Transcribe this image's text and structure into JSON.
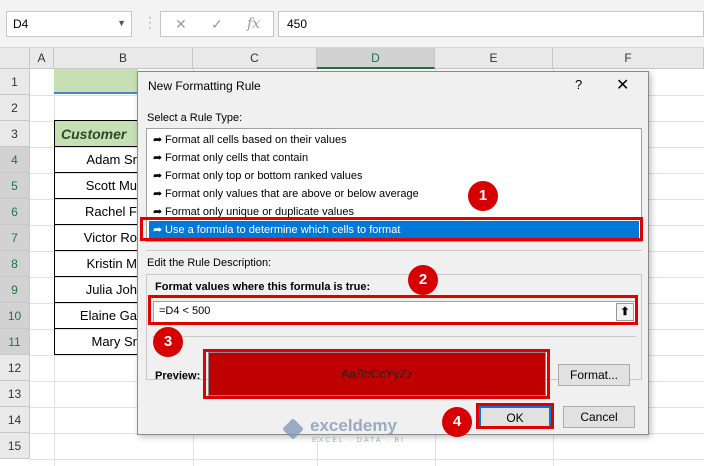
{
  "formula_bar": {
    "name_box": "D4",
    "cancel_icon": "✕",
    "enter_icon": "✓",
    "fx_icon": "fx",
    "value": "450"
  },
  "columns": [
    "A",
    "B",
    "C",
    "D",
    "E",
    "F"
  ],
  "rows": [
    "1",
    "2",
    "3",
    "4",
    "5",
    "6",
    "7",
    "8",
    "9",
    "10",
    "11",
    "12",
    "13",
    "14",
    "15"
  ],
  "sheet": {
    "header_cell": "Customer",
    "names": [
      "Adam Sr",
      "Scott Mu",
      "Rachel F",
      "Victor Ro",
      "Kristin M",
      "Julia Joh",
      "Elaine Ga",
      "Mary Sr"
    ]
  },
  "dialog": {
    "title": "New Formatting Rule",
    "help": "?",
    "close": "✕",
    "select_rule_label": "Select a Rule Type:",
    "rule_types": [
      "Format all cells based on their values",
      "Format only cells that contain",
      "Format only top or bottom ranked values",
      "Format only values that are above or below average",
      "Format only unique or duplicate values",
      "Use a formula to determine which cells to format"
    ],
    "edit_label": "Edit the Rule Description:",
    "formula_label": "Format values where this formula is true:",
    "formula_value": "=D4 < 500",
    "preview_label": "Preview:",
    "preview_sample": "AaBbCcYyZz",
    "format_button": "Format...",
    "ok_button": "OK",
    "cancel_button": "Cancel"
  },
  "annotations": [
    "1",
    "2",
    "3",
    "4"
  ],
  "watermark": {
    "name": "exceldemy",
    "tagline": "EXCEL · DATA · BI"
  },
  "colors": {
    "selection_blue": "#0078d7",
    "annotation_red": "#e00000",
    "preview_fill": "#c00000",
    "header_green": "#c6e0b4"
  }
}
